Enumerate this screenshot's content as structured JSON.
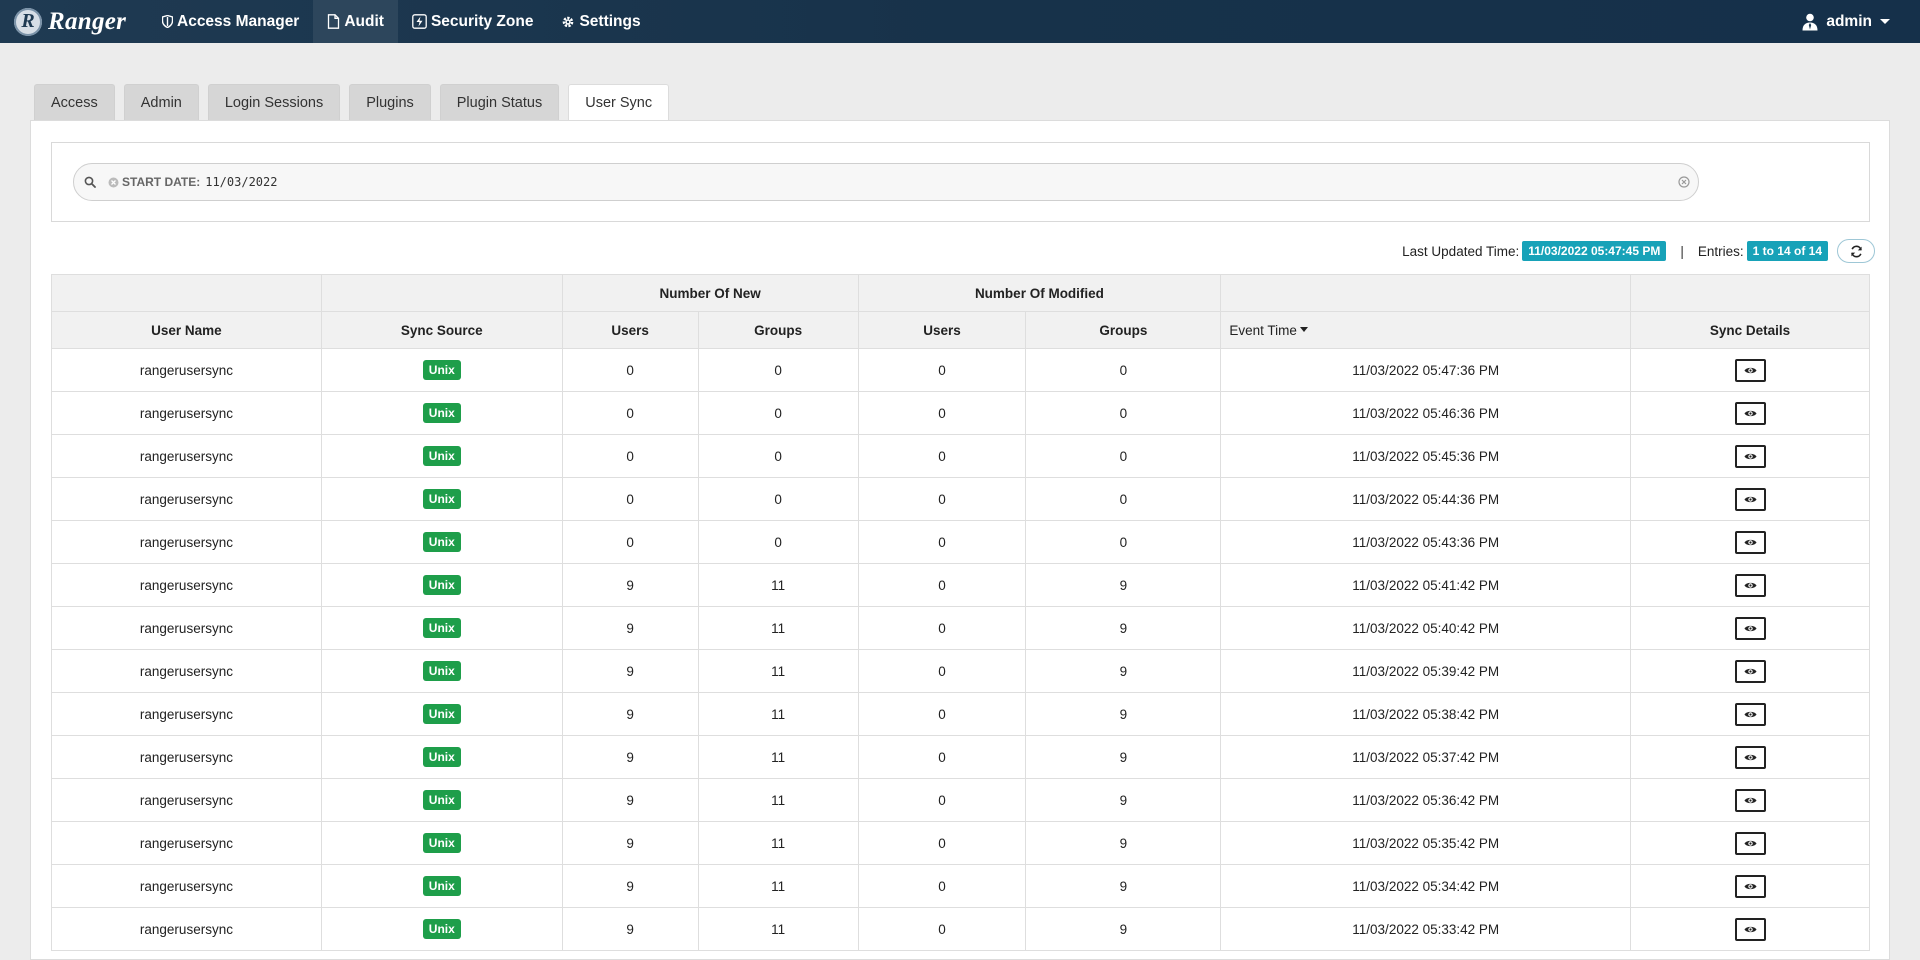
{
  "navbar": {
    "brand": "Ranger",
    "logo_letter": "R",
    "items": [
      {
        "label": "Access Manager",
        "icon": "shield-icon"
      },
      {
        "label": "Audit",
        "icon": "file-icon"
      },
      {
        "label": "Security Zone",
        "icon": "bolt-icon"
      },
      {
        "label": "Settings",
        "icon": "gear-icon"
      }
    ],
    "active_item": "Audit",
    "user": "admin"
  },
  "tabs": [
    "Access",
    "Admin",
    "Login Sessions",
    "Plugins",
    "Plugin Status",
    "User Sync"
  ],
  "active_tab": "User Sync",
  "search": {
    "facet_label": "START DATE:",
    "facet_value": "11/03/2022"
  },
  "info": {
    "last_updated_label": "Last Updated Time:",
    "last_updated_value": "11/03/2022 05:47:45 PM",
    "separator": "|",
    "entries_label": "Entries:",
    "entries_value": "1 to 14 of 14"
  },
  "table": {
    "group_headers": {
      "new": "Number Of New",
      "modified": "Number Of Modified"
    },
    "columns": {
      "user_name": "User Name",
      "sync_source": "Sync Source",
      "new_users": "Users",
      "new_groups": "Groups",
      "mod_users": "Users",
      "mod_groups": "Groups",
      "event_time": "Event Time",
      "sync_details": "Sync Details"
    },
    "rows": [
      {
        "user": "rangerusersync",
        "source": "Unix",
        "new_users": "0",
        "new_groups": "0",
        "mod_users": "0",
        "mod_groups": "0",
        "time": "11/03/2022 05:47:36 PM"
      },
      {
        "user": "rangerusersync",
        "source": "Unix",
        "new_users": "0",
        "new_groups": "0",
        "mod_users": "0",
        "mod_groups": "0",
        "time": "11/03/2022 05:46:36 PM"
      },
      {
        "user": "rangerusersync",
        "source": "Unix",
        "new_users": "0",
        "new_groups": "0",
        "mod_users": "0",
        "mod_groups": "0",
        "time": "11/03/2022 05:45:36 PM"
      },
      {
        "user": "rangerusersync",
        "source": "Unix",
        "new_users": "0",
        "new_groups": "0",
        "mod_users": "0",
        "mod_groups": "0",
        "time": "11/03/2022 05:44:36 PM"
      },
      {
        "user": "rangerusersync",
        "source": "Unix",
        "new_users": "0",
        "new_groups": "0",
        "mod_users": "0",
        "mod_groups": "0",
        "time": "11/03/2022 05:43:36 PM"
      },
      {
        "user": "rangerusersync",
        "source": "Unix",
        "new_users": "9",
        "new_groups": "11",
        "mod_users": "0",
        "mod_groups": "9",
        "time": "11/03/2022 05:41:42 PM"
      },
      {
        "user": "rangerusersync",
        "source": "Unix",
        "new_users": "9",
        "new_groups": "11",
        "mod_users": "0",
        "mod_groups": "9",
        "time": "11/03/2022 05:40:42 PM"
      },
      {
        "user": "rangerusersync",
        "source": "Unix",
        "new_users": "9",
        "new_groups": "11",
        "mod_users": "0",
        "mod_groups": "9",
        "time": "11/03/2022 05:39:42 PM"
      },
      {
        "user": "rangerusersync",
        "source": "Unix",
        "new_users": "9",
        "new_groups": "11",
        "mod_users": "0",
        "mod_groups": "9",
        "time": "11/03/2022 05:38:42 PM"
      },
      {
        "user": "rangerusersync",
        "source": "Unix",
        "new_users": "9",
        "new_groups": "11",
        "mod_users": "0",
        "mod_groups": "9",
        "time": "11/03/2022 05:37:42 PM"
      },
      {
        "user": "rangerusersync",
        "source": "Unix",
        "new_users": "9",
        "new_groups": "11",
        "mod_users": "0",
        "mod_groups": "9",
        "time": "11/03/2022 05:36:42 PM"
      },
      {
        "user": "rangerusersync",
        "source": "Unix",
        "new_users": "9",
        "new_groups": "11",
        "mod_users": "0",
        "mod_groups": "9",
        "time": "11/03/2022 05:35:42 PM"
      },
      {
        "user": "rangerusersync",
        "source": "Unix",
        "new_users": "9",
        "new_groups": "11",
        "mod_users": "0",
        "mod_groups": "9",
        "time": "11/03/2022 05:34:42 PM"
      },
      {
        "user": "rangerusersync",
        "source": "Unix",
        "new_users": "9",
        "new_groups": "11",
        "mod_users": "0",
        "mod_groups": "9",
        "time": "11/03/2022 05:33:42 PM"
      }
    ]
  },
  "colors": {
    "navbar": "#1f3a52",
    "unix_badge": "#1e9e4a",
    "info_badge": "#17a2b8"
  }
}
